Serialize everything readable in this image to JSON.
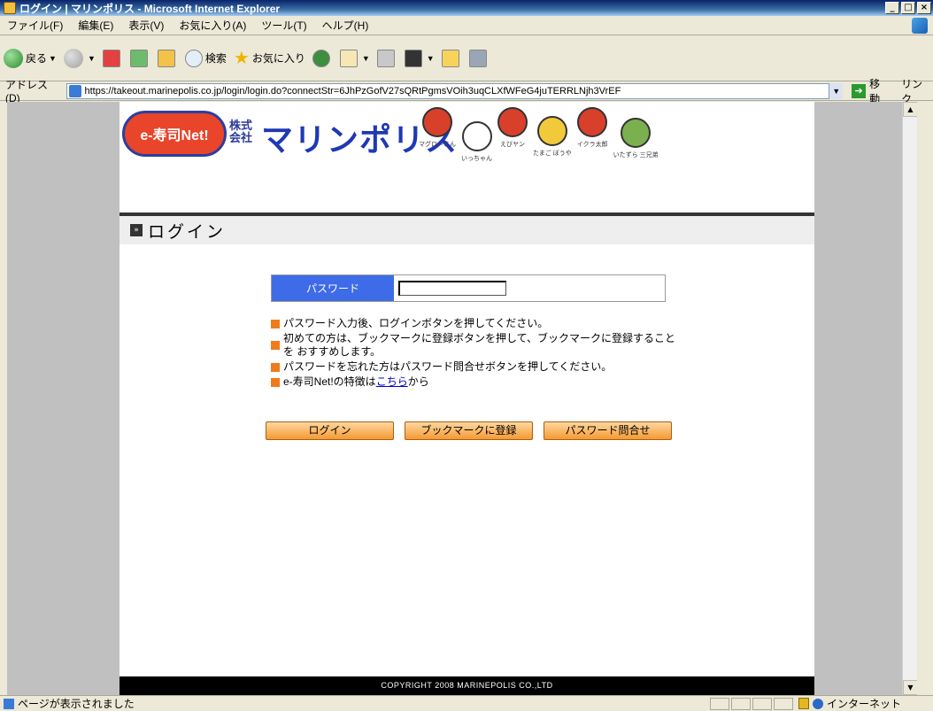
{
  "window": {
    "title": "ログイン | マリンポリス - Microsoft Internet Explorer",
    "buttons": [
      "_",
      "□",
      "×"
    ]
  },
  "menu": [
    "ファイル(F)",
    "編集(E)",
    "表示(V)",
    "お気に入り(A)",
    "ツール(T)",
    "ヘルプ(H)"
  ],
  "toolbar": {
    "back": "戻る",
    "search": "検索",
    "favorites": "お気に入り"
  },
  "address": {
    "label": "アドレス(D)",
    "url": "https://takeout.marinepolis.co.jp/login/login.do?connectStr=6JhPzGofV27sQRtPgmsVOih3uqCLXfWFeG4juTERRLNjh3VrEF",
    "go": "移動",
    "links": "リンク"
  },
  "header": {
    "logo_text": "e-寿司Net!",
    "company_prefix": "株式\n会社",
    "company_name": "マリンポリス",
    "characters": [
      {
        "label": "マグロ〜さん",
        "color": "red"
      },
      {
        "label": "いっちゃん",
        "color": "white"
      },
      {
        "label": "えびヤン",
        "color": "red"
      },
      {
        "label": "たまご ぼうや",
        "color": "yellow"
      },
      {
        "label": "イクラ太郎",
        "color": "red"
      },
      {
        "label": "いたずら 三兄弟",
        "color": "green"
      }
    ]
  },
  "section": {
    "icon": "»",
    "title": "ログイン"
  },
  "form": {
    "password_label": "パスワード",
    "password_value": ""
  },
  "notes": [
    "パスワード入力後、ログインボタンを押してください。",
    "初めての方は、ブックマークに登録ボタンを押して、ブックマークに登録することを おすすめします。",
    "パスワードを忘れた方はパスワード問合せボタンを押してください。"
  ],
  "note_link": {
    "prefix": "e-寿司Net!の特徴は",
    "link": "こちら",
    "suffix": "から"
  },
  "buttons": {
    "login": "ログイン",
    "bookmark": "ブックマークに登録",
    "password_inquiry": "パスワード問合せ"
  },
  "footer": "COPYRIGHT 2008 MARINEPOLIS CO.,LTD",
  "status": {
    "text": "ページが表示されました",
    "zone": "インターネット"
  }
}
